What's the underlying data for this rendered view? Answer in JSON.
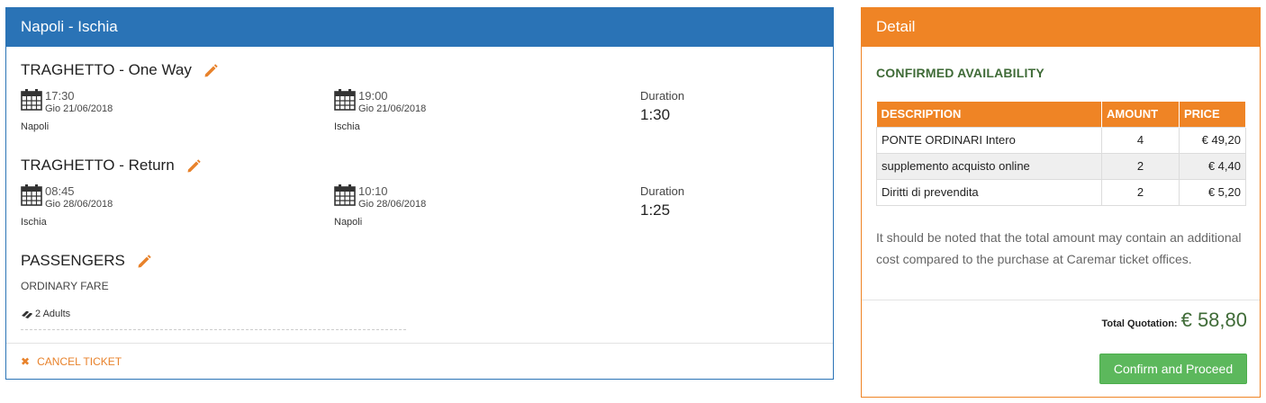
{
  "route": {
    "title": "Napoli - Ischia"
  },
  "outbound": {
    "title": "TRAGHETTO - One Way",
    "depart": {
      "time": "17:30",
      "date": "Gio  21/06/2018",
      "place": "Napoli"
    },
    "arrive": {
      "time": "19:00",
      "date": "Gio  21/06/2018",
      "place": "Ischia"
    },
    "duration_label": "Duration",
    "duration": "1:30"
  },
  "return": {
    "title": "TRAGHETTO - Return",
    "depart": {
      "time": "08:45",
      "date": "Gio  28/06/2018",
      "place": "Ischia"
    },
    "arrive": {
      "time": "10:10",
      "date": "Gio  28/06/2018",
      "place": "Napoli"
    },
    "duration_label": "Duration",
    "duration": "1:25"
  },
  "passengers": {
    "title": "PASSENGERS",
    "fare": "ORDINARY FARE",
    "count": "2 Adults"
  },
  "cancel_label": "CANCEL TICKET",
  "detail": {
    "title": "Detail",
    "availability": "CONFIRMED AVAILABILITY",
    "columns": [
      "DESCRIPTION",
      "AMOUNT",
      "PRICE"
    ],
    "rows": [
      {
        "description": "PONTE ORDINARI Intero",
        "amount": "4",
        "price": "€ 49,20"
      },
      {
        "description": "supplemento acquisto online",
        "amount": "2",
        "price": "€ 4,40"
      },
      {
        "description": "Diritti di prevendita",
        "amount": "2",
        "price": "€ 5,20"
      }
    ],
    "note": "It should be noted that the total amount may contain an additional cost compared to the purchase at Caremar ticket offices.",
    "total_label": "Total Quotation:",
    "total_value": "€ 58,80",
    "confirm_label": "Confirm and Proceed"
  },
  "colors": {
    "primary": "#2a73b6",
    "accent": "#ef8425",
    "success": "#5cb85c",
    "confirmed": "#3f6b37"
  },
  "icons": {
    "edit": "pencil-icon",
    "calendar": "calendar-icon",
    "passengers": "ticket-icon",
    "cancel": "close-icon"
  }
}
